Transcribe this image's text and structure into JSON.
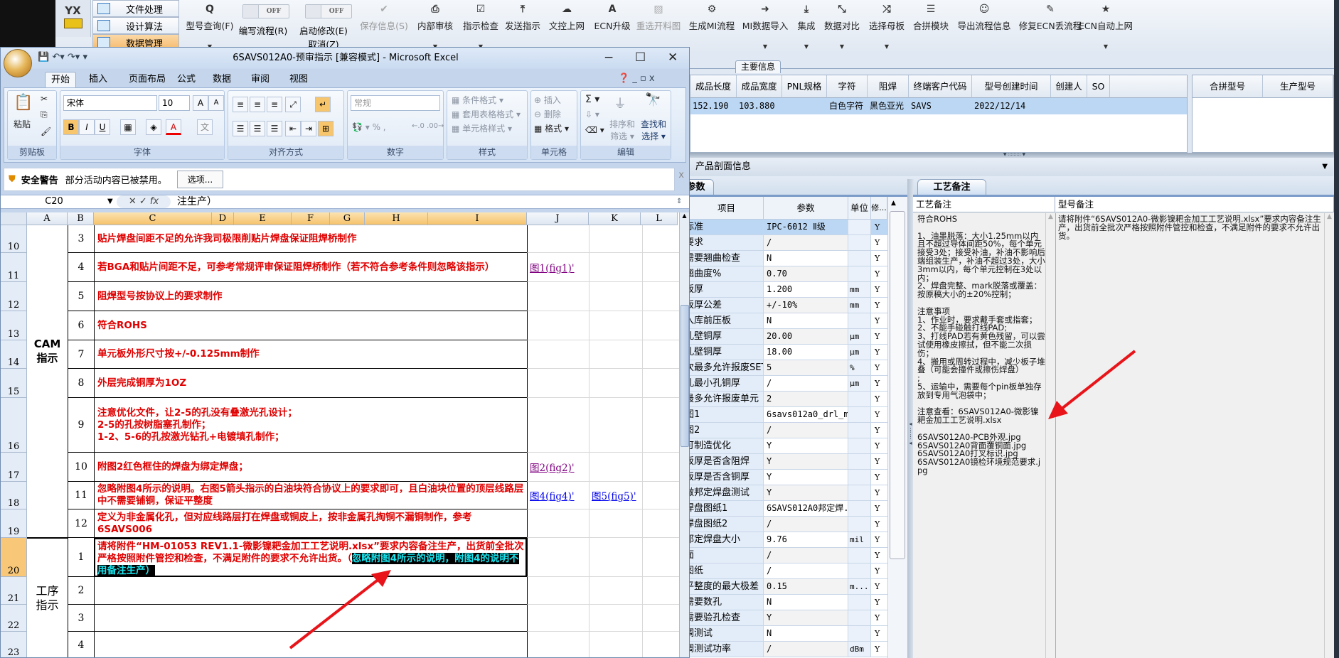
{
  "app": {
    "logo_text": "YX",
    "nav": [
      {
        "label": "文件处理"
      },
      {
        "label": "设计算法"
      },
      {
        "label": "数据管理",
        "active": true
      }
    ],
    "toolbar": {
      "model_query": {
        "label": "型号查询(F)",
        "icon": "search-icon"
      },
      "write_flow": {
        "state": "OFF",
        "label": "编写流程(R)"
      },
      "start_modify": {
        "state": "OFF",
        "label": "启动修改(E)",
        "cancel": "取消(Z)"
      },
      "save_info": {
        "label": "保存信息(S)",
        "icon": "check-icon",
        "disabled": true
      },
      "internal_review": {
        "label": "内部审核",
        "icon": "printer-icon"
      },
      "instruction_check": {
        "label": "指示检查",
        "icon": "checkbox-icon"
      },
      "send_instruction": {
        "label": "发送指示",
        "icon": "upload-icon"
      },
      "doc_control_upload": {
        "label": "文控上网",
        "icon": "cloud-upload-icon"
      },
      "ecn_upgrade": {
        "label": "ECN升级",
        "icon": "font-icon"
      },
      "reselect_cut_chart": {
        "label": "重选开料图",
        "icon": "image-icon",
        "disabled": true
      },
      "generate_mi_flow": {
        "label": "生成MI流程",
        "icon": "gears-icon"
      },
      "mi_data_import": {
        "label": "MI数据导入",
        "icon": "sign-in-icon"
      },
      "integrate": {
        "label": "集成",
        "icon": "download-icon"
      },
      "data_compare": {
        "label": "数据对比",
        "icon": "compress-icon"
      },
      "select_master_board": {
        "label": "选择母板",
        "icon": "shuffle-icon"
      },
      "merge_module": {
        "label": "合拼模块",
        "icon": "list-icon"
      },
      "export_flow_info": {
        "label": "导出流程信息",
        "icon": "smile-icon"
      },
      "repair_ecn_flow": {
        "label": "修复ECN丢流程",
        "icon": "wrench-icon"
      },
      "ecn_auto_upload": {
        "label": "ECN自动上网",
        "icon": "star-icon"
      }
    },
    "main_info": {
      "group_label": "主要信息",
      "columns": [
        "成品长度",
        "成品宽度",
        "PNL规格",
        "字符",
        "阻焊",
        "终端客户代码",
        "型号创建时间",
        "创建人",
        "SO"
      ],
      "row": [
        "152.190",
        "103.880",
        "",
        "白色字符",
        "黑色亚光",
        "SAVS",
        "2022/12/14",
        "",
        ""
      ],
      "merge_columns": [
        "合拼型号",
        "生产型号"
      ]
    },
    "section_title": "产品剖面信息",
    "params": {
      "tab": "参数",
      "columns": [
        "项目",
        "参数",
        "单位",
        "修..."
      ],
      "rows": [
        {
          "item": "标准",
          "value": "IPC-6012 Ⅱ级",
          "unit": "",
          "mod": "Y"
        },
        {
          "item": "要求",
          "value": "/",
          "unit": "",
          "mod": "Y"
        },
        {
          "item": "需要翘曲检查",
          "value": "N",
          "unit": "",
          "mod": "Y"
        },
        {
          "item": "翘曲度%",
          "value": "0.70",
          "unit": "",
          "mod": "Y"
        },
        {
          "item": "板厚",
          "value": "1.200",
          "unit": "mm",
          "mod": "Y"
        },
        {
          "item": "板厚公差",
          "value": "+/-10%",
          "unit": "mm",
          "mod": "Y"
        },
        {
          "item": "入库前压板",
          "value": "N",
          "unit": "",
          "mod": "Y"
        },
        {
          "item": "孔壁铜厚",
          "value": "20.00",
          "unit": "μm",
          "mod": "Y"
        },
        {
          "item": "孔壁铜厚",
          "value": "18.00",
          "unit": "μm",
          "mod": "Y"
        },
        {
          "item": "次最多允许报废SET",
          "value": "5",
          "unit": "%",
          "mod": "Y"
        },
        {
          "item": "孔最小孔铜厚",
          "value": "/",
          "unit": "μm",
          "mod": "Y"
        },
        {
          "item": "最多允许报废单元",
          "value": "2",
          "unit": "",
          "mod": "Y"
        },
        {
          "item": "图1",
          "value": "6savs012a0_drl_m...",
          "unit": "",
          "mod": "Y"
        },
        {
          "item": "图2",
          "value": "/",
          "unit": "",
          "mod": "Y"
        },
        {
          "item": "可制造优化",
          "value": "Y",
          "unit": "",
          "mod": "Y"
        },
        {
          "item": "板厚是否含阻焊",
          "value": "Y",
          "unit": "",
          "mod": "Y"
        },
        {
          "item": "板厚是否含铜厚",
          "value": "Y",
          "unit": "",
          "mod": "Y"
        },
        {
          "item": "做邦定焊盘测试",
          "value": "Y",
          "unit": "",
          "mod": "Y"
        },
        {
          "item": "焊盘图纸1",
          "value": "6SAVS012A0邦定焊...",
          "unit": "",
          "mod": "Y"
        },
        {
          "item": "焊盘图纸2",
          "value": "/",
          "unit": "",
          "mod": "Y"
        },
        {
          "item": "邦定焊盘大小",
          "value": "9.76",
          "unit": "mil",
          "mod": "Y"
        },
        {
          "item": "面",
          "value": "/",
          "unit": "",
          "mod": "Y"
        },
        {
          "item": "图纸",
          "value": "/",
          "unit": "",
          "mod": "Y"
        },
        {
          "item": "平整度的最大极差",
          "value": "0.15",
          "unit": "m...",
          "mod": "Y"
        },
        {
          "item": "需要数孔",
          "value": "N",
          "unit": "",
          "mod": "Y"
        },
        {
          "item": "需要验孔检查",
          "value": "Y",
          "unit": "",
          "mod": "Y"
        },
        {
          "item": "调测试",
          "value": "N",
          "unit": "",
          "mod": "Y"
        },
        {
          "item": "调测试功率",
          "value": "/",
          "unit": "dBm",
          "mod": "Y"
        }
      ]
    },
    "notes": {
      "tab": "工艺备注",
      "process_header": "工艺备注",
      "model_header": "型号备注",
      "process_text": "符合ROHS\n\n1、油墨脱落：大小1.25mm以内且不超过导体间距50%，每个单元接受3处；接受补油，补油不影响后端组装生产，补油不超过3处，大小3mm以内，每个单元控制在3处以内；\n2、焊盘完整、mark脱落或覆盖：按原稿大小的±20%控制；\n\n注意事项\n1、作业时，要求戴手套或指套；\n2、不能手碰触打线PAD;\n3、打线PAD若有黄色残留，可以尝试使用橡皮擦拭，但不能二次损伤；\n4、搬用或周转过程中，减少板子堆叠（可能会撞件或擦伤焊盘）\n;\n5、运输中，需要每个pin板单独存放到专用气泡袋中；\n\n注意查看：6SAVS012A0-微影镍耙金加工工艺说明.xlsx\n\n6SAVS012A0-PCB外观.jpg\n6SAVS012A0背面覆铜面.jpg\n6SAVS012A0打叉标识.jpg\n6SAVS012A0镜检环境规范要求.jpg",
      "model_text": "请将附件“6SAVS012A0-微影镍耙金加工工艺说明.xlsx”要求内容备注生产，出货前全批次严格按照附件管控和检查，不满足附件的要求不允许出货。"
    }
  },
  "excel": {
    "title": "6SAVS012A0-预审指示  [兼容模式] - Microsoft Excel",
    "tabs": [
      "开始",
      "插入",
      "页面布局",
      "公式",
      "数据",
      "审阅",
      "视图"
    ],
    "active_tab": "开始",
    "ribbon": {
      "paste": "粘贴",
      "font_name": "宋体",
      "font_size": "10",
      "number_format": "常规",
      "cond_format": "条件格式",
      "table_format": "套用表格格式",
      "cell_style": "单元格样式",
      "insert": "插入",
      "delete": "删除",
      "format": "格式",
      "sort_filter_1": "排序和",
      "sort_filter_2": "筛选",
      "find_select_1": "查找和",
      "find_select_2": "选择",
      "groups": [
        "剪贴板",
        "字体",
        "对齐方式",
        "数字",
        "样式",
        "单元格",
        "编辑"
      ]
    },
    "security": {
      "title": "安全警告",
      "message": "部分活动内容已被禁用。",
      "button": "选项..."
    },
    "name_box": "C20",
    "formula": "注生产）",
    "columns": [
      "A",
      "B",
      "C",
      "D",
      "E",
      "F",
      "G",
      "H",
      "I",
      "J",
      "K",
      "L"
    ],
    "selected_cell": "C20",
    "section_labels": {
      "cam": "CAM\n指示",
      "process": "工序\n指示"
    },
    "rows": [
      {
        "num": "10",
        "b": "3",
        "c": "贴片焊盘间距不足的允许我司极限削贴片焊盘保证阻焊桥制作"
      },
      {
        "num": "11",
        "b": "4",
        "c": "若BGA和贴片间距不足，可参考常规评审保证阻焊桥制作（若不符合参考条件则忽略该指示）",
        "j": "图1(fig1)'",
        "j_visited": true
      },
      {
        "num": "12",
        "b": "5",
        "c": "阻焊型号按协议上的要求制作"
      },
      {
        "num": "13",
        "b": "6",
        "c": "符合ROHS"
      },
      {
        "num": "14",
        "b": "7",
        "c": "单元板外形尺寸按+/-0.125mm制作"
      },
      {
        "num": "15",
        "b": "8",
        "c": "外层完成铜厚为1OZ"
      },
      {
        "num": "16",
        "b": "9",
        "c": "注意优化文件，让2-5的孔没有叠激光孔设计；\n2-5的孔按树脂塞孔制作；\n1-2、5-6的孔按激光钻孔+电镀填孔制作；"
      },
      {
        "num": "17",
        "b": "10",
        "c": "附图2红色框住的焊盘为绑定焊盘；",
        "j": "图2(fig2)'",
        "j_visited": true
      },
      {
        "num": "18",
        "b": "11",
        "c": "忽略附图4所示的说明。右图5箭头指示的白油块符合协议上的要求即可，且白油块位置的顶层线路层中不需要铺铜，保证平整度",
        "j": "图4(fig4)'",
        "k": "图5(fig5)'"
      },
      {
        "num": "19",
        "b": "12",
        "c": "定义为非金属化孔，但对应线路层打在焊盘或铜皮上，按非金属孔掏铜不漏铜制作，参考6SAVS006"
      },
      {
        "num": "20",
        "b": "1",
        "c": "请将附件“HM-01053 REV1.1-微影镍耙金加工工艺说明.xlsx”要求内容备注生产，出货前全批次严格按照附件管控和检查，不满足附件的要求不允许出货。（",
        "c_highlight": "忽略附图4所示的说明，附图4的说明不用备注生产）",
        "selected": true
      },
      {
        "num": "21",
        "b": "2",
        "c": ""
      },
      {
        "num": "22",
        "b": "3",
        "c": ""
      },
      {
        "num": "23",
        "b": "4",
        "c": ""
      }
    ]
  },
  "colors": {
    "accent_red": "#e8141a",
    "cell_text_red": "#e00000",
    "highlight_bg": "#000000",
    "highlight_text": "#19e6f0",
    "selection_orange": "#f6c26c"
  }
}
